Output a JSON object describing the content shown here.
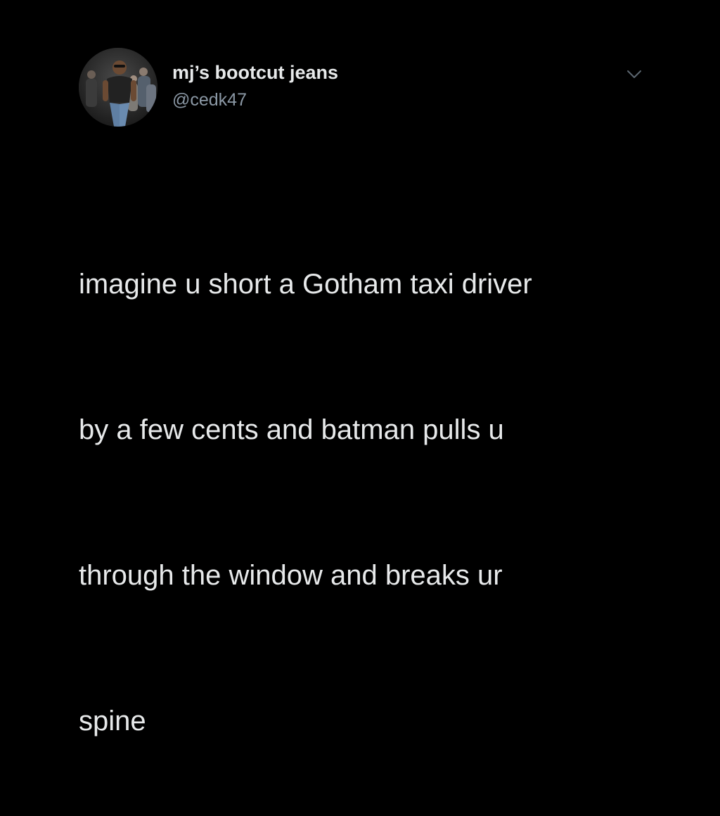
{
  "tweet": {
    "author": {
      "display_name": "mj’s bootcut jeans",
      "handle": "@cedk47",
      "avatar_icon": "profile-photo"
    },
    "menu_icon": "chevron-down-icon",
    "text_lines": [
      "imagine u short a Gotham taxi driver",
      "by a few cents and batman pulls u",
      "through the window and breaks ur",
      "spine"
    ]
  },
  "colors": {
    "background": "#000000",
    "primary_text": "#e7e9ea",
    "secondary_text": "#8b98a5"
  }
}
